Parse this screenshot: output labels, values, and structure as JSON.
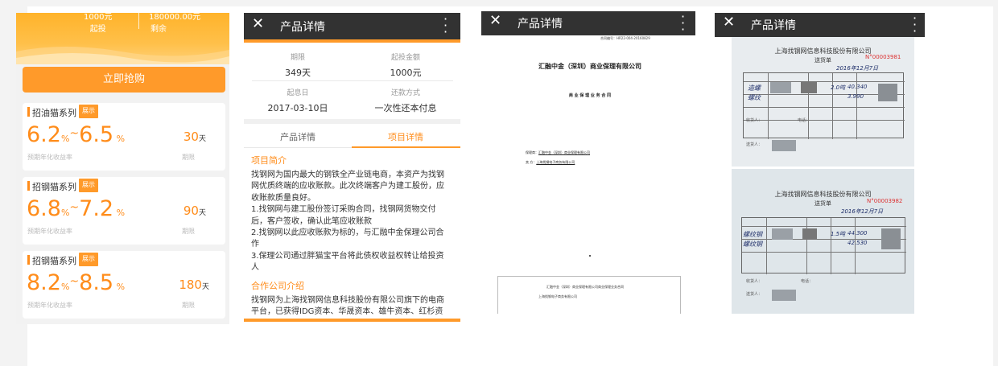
{
  "colors": {
    "accent": "#ff9a2a",
    "appbar": "#323232",
    "rate": "#ff8c1a"
  },
  "panel1": {
    "stats": [
      {
        "value": "1000元",
        "label": "起投"
      },
      {
        "value": "180000.00元",
        "label": "剩余"
      }
    ],
    "buy_button": "立即抢购",
    "products": [
      {
        "name": "招油猫系列",
        "tag": "展示",
        "rate_low": "6.2",
        "rate_high": "6.5",
        "pct": "%",
        "dash": "~",
        "rate_label": "预期年化收益率",
        "days": "30",
        "days_unit": "天",
        "days_label": "期限"
      },
      {
        "name": "招钢猫系列",
        "tag": "展示",
        "rate_low": "6.8",
        "rate_high": "7.2",
        "pct": "%",
        "dash": "~",
        "rate_label": "预期年化收益率",
        "days": "90",
        "days_unit": "天",
        "days_label": "期限"
      },
      {
        "name": "招钢猫系列",
        "tag": "展示",
        "rate_low": "8.2",
        "rate_high": "8.5",
        "pct": "%",
        "dash": "~",
        "rate_label": "预期年化收益率",
        "days": "180",
        "days_unit": "天",
        "days_label": "期限"
      }
    ]
  },
  "appbar": {
    "close_icon": "close-icon",
    "title": "产品详情",
    "menu_icon": "more-vert-icon"
  },
  "panel2": {
    "info": [
      {
        "k": "期限",
        "v": "349天"
      },
      {
        "k": "起投金额",
        "v": "1000元"
      },
      {
        "k": "起息日",
        "v": "2017-03-10日"
      },
      {
        "k": "还款方式",
        "v": "一次性还本付息"
      }
    ],
    "tabs": [
      "产品详情",
      "项目详情"
    ],
    "section1_title": "项目简介",
    "section1_lines": [
      "找钢网为国内最大的钢铁全产业链电商，本资产为找钢",
      "网优质终端的应收账款。此次终端客户为建工股份，应",
      "收账款质量良好。",
      "1.找钢网与建工股份签订采购合同，找钢网货物交付",
      "后，客户签收，确认此笔应收账款",
      "2.找钢网以此应收账款为标的，与汇融中金保理公司合",
      "作",
      "3.保理公司通过胖猫宝平台将此债权收益权转让给投资",
      "人"
    ],
    "section2_title": "合作公司介绍",
    "section2_lines": [
      "找钢网为上海找钢网信息科技股份有限公司旗下的电商",
      "平台，已获得IDG资本、华晟资本、雄牛资本、红杉资"
    ]
  },
  "panel3": {
    "contract_no": "合同编号：HR22-004-20160829",
    "heading": "汇融中金（深圳）商业保理有限公司",
    "subheading": "商 业 保 理 业 务 合 同",
    "party_a_label": "保理商：",
    "party_a": "汇融中金（深圳）商业保理有限公司",
    "party_b_label": "卖 方：",
    "party_b": "上海找钢电子商务有限公司",
    "box_line1": "汇融中金（深圳）商业保理有限公司商业保理业务合同",
    "box_line2": "上海找钢电子商务有限公司"
  },
  "panel4": {
    "company": "上海找钢网信息科技股份有限公司",
    "doc_title": "送货单",
    "no1": "N°00003981",
    "no2": "N°00003982",
    "date1": "2016年12月7日",
    "date2": "2016年12月7日",
    "rows1": [
      "造螺",
      "螺纹",
      "2.0吨",
      "40.340",
      "3.990"
    ],
    "rows2": [
      "螺纹钢",
      "螺纹钢",
      "1.5吨",
      "44.300",
      "42.530"
    ],
    "receiver_label": "收货人：",
    "sender_label": "送货人：",
    "phone_label": "电话："
  }
}
